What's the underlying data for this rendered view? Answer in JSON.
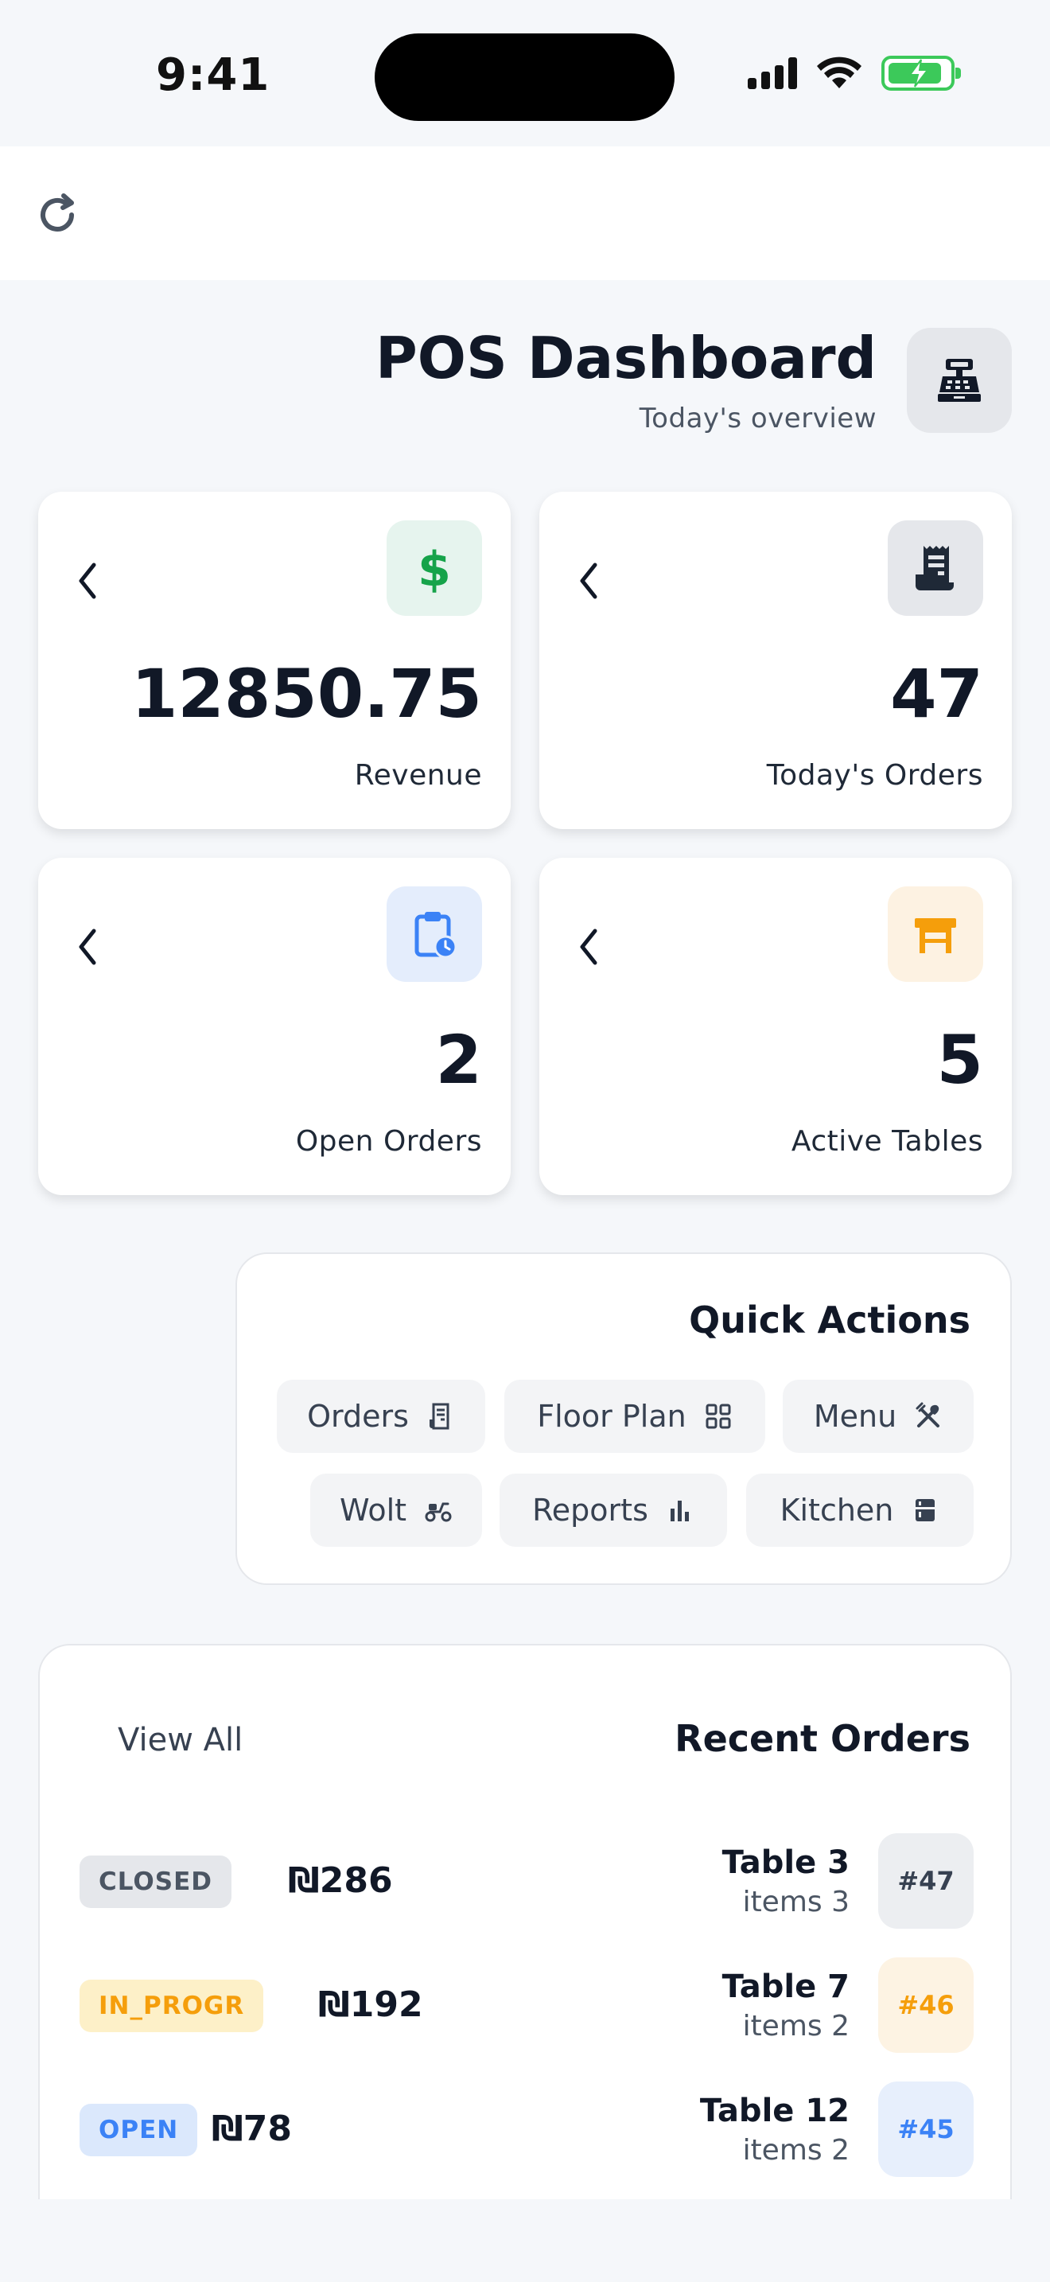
{
  "status_bar": {
    "time": "9:41"
  },
  "header": {
    "title": "POS Dashboard",
    "subtitle": "Today's overview"
  },
  "stats": [
    {
      "value": "12850.75",
      "label": "Revenue",
      "icon": "dollar-icon",
      "color": "#16a34a"
    },
    {
      "value": "47",
      "label": "Today's Orders",
      "icon": "receipt-icon",
      "color": "#1f2937"
    },
    {
      "value": "2",
      "label": "Open Orders",
      "icon": "clipboard-clock-icon",
      "color": "#3b82f6"
    },
    {
      "value": "5",
      "label": "Active Tables",
      "icon": "table-icon",
      "color": "#f59e0b"
    }
  ],
  "quick_actions": {
    "title": "Quick Actions",
    "items": [
      {
        "label": "Orders",
        "icon": "receipt-icon"
      },
      {
        "label": "Floor Plan",
        "icon": "grid-icon"
      },
      {
        "label": "Menu",
        "icon": "utensils-icon"
      },
      {
        "label": "Wolt",
        "icon": "scooter-icon"
      },
      {
        "label": "Reports",
        "icon": "bar-chart-icon"
      },
      {
        "label": "Kitchen",
        "icon": "kitchen-icon"
      }
    ]
  },
  "recent_orders": {
    "title": "Recent Orders",
    "view_all": "View All",
    "rows": [
      {
        "number": "#47",
        "table": "Table 3",
        "items": "items 3",
        "status": "CLOSED",
        "amount": "₪286"
      },
      {
        "number": "#46",
        "table": "Table 7",
        "items": "items 2",
        "status": "IN_PROGR",
        "amount": "₪192"
      },
      {
        "number": "#45",
        "table": "Table 12",
        "items": "items 2",
        "status": "OPEN",
        "amount": "₪78"
      }
    ]
  }
}
